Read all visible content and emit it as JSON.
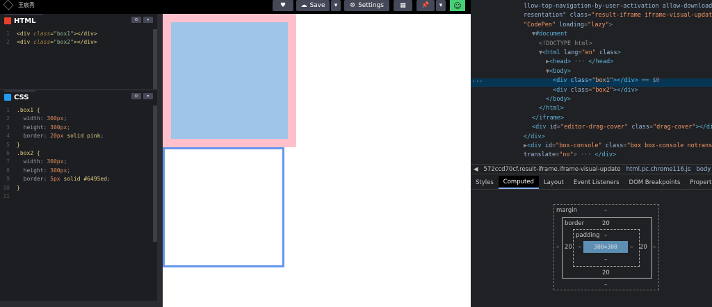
{
  "topbar": {
    "user_name": "王宸秀",
    "heart_icon_label": "♥",
    "save_label": "Save",
    "settings_label": "Settings",
    "avatar_glyph": "☺"
  },
  "html_panel": {
    "title": "HTML",
    "lines": [
      {
        "n": "1",
        "parts": [
          [
            "tag",
            "<div "
          ],
          [
            "attr",
            "class"
          ],
          [
            "tag",
            "="
          ],
          [
            "str",
            "\"box1\""
          ],
          [
            "tag",
            "></div>"
          ]
        ]
      },
      {
        "n": "2",
        "parts": [
          [
            "tag",
            "<div "
          ],
          [
            "attr",
            "class"
          ],
          [
            "tag",
            "="
          ],
          [
            "str",
            "\"box2\""
          ],
          [
            "tag",
            "></div>"
          ]
        ]
      }
    ]
  },
  "css_panel": {
    "title": "CSS",
    "lines": [
      {
        "n": "1",
        "parts": [
          [
            "sel",
            ".box1 {"
          ]
        ]
      },
      {
        "n": "2",
        "parts": [
          [
            "prop",
            "  width: "
          ],
          [
            "num",
            "300px"
          ],
          [
            "prop",
            ";"
          ]
        ]
      },
      {
        "n": "3",
        "parts": [
          [
            "prop",
            "  height: "
          ],
          [
            "num",
            "300px"
          ],
          [
            "prop",
            ";"
          ]
        ]
      },
      {
        "n": "4",
        "parts": [
          [
            "prop",
            "  border: "
          ],
          [
            "num",
            "20px"
          ],
          [
            "prop",
            " "
          ],
          [
            "kw",
            "solid pink"
          ],
          [
            "prop",
            ";"
          ]
        ]
      },
      {
        "n": "5",
        "parts": [
          [
            "sel",
            "}"
          ]
        ]
      },
      {
        "n": "6",
        "parts": [
          [
            "sel",
            ".box2 {"
          ]
        ]
      },
      {
        "n": "7",
        "parts": [
          [
            "prop",
            "  width: "
          ],
          [
            "num",
            "300px"
          ],
          [
            "prop",
            ";"
          ]
        ]
      },
      {
        "n": "8",
        "parts": [
          [
            "prop",
            "  height: "
          ],
          [
            "num",
            "300px"
          ],
          [
            "prop",
            ";"
          ]
        ]
      },
      {
        "n": "9",
        "parts": [
          [
            "prop",
            "  border: "
          ],
          [
            "num",
            "5px"
          ],
          [
            "prop",
            " "
          ],
          [
            "kw",
            "solid #6495ed"
          ],
          [
            "prop",
            ";"
          ]
        ]
      },
      {
        "n": "10",
        "parts": [
          [
            "sel",
            "}"
          ]
        ]
      },
      {
        "n": "11",
        "parts": []
      }
    ]
  },
  "devtools": {
    "elements": [
      {
        "indent": 0,
        "parts": [
          [
            "attr",
            "llow-top-navigation-by-user-activation allow-downloads"
          ]
        ]
      },
      {
        "indent": 0,
        "parts": [
          [
            "attr",
            "resentation\" "
          ],
          [
            "dt-attr",
            "class"
          ],
          [
            "eq",
            "="
          ],
          [
            "val",
            "\"result-iframe iframe-visual-update"
          ]
        ]
      },
      {
        "indent": 0,
        "parts": [
          [
            "val",
            "\"CodePen\""
          ],
          [
            "attr",
            " loading"
          ],
          [
            "eq",
            "="
          ],
          [
            "val",
            "\"lazy\""
          ],
          [
            "eq",
            ">"
          ]
        ]
      },
      {
        "indent": 1,
        "parts": [
          [
            "eq",
            "▼"
          ],
          [
            "tag",
            "#document"
          ]
        ]
      },
      {
        "indent": 2,
        "parts": [
          [
            "eq",
            "<!DOCTYPE html>"
          ]
        ]
      },
      {
        "indent": 2,
        "parts": [
          [
            "eq",
            "▼"
          ],
          [
            "tag",
            "<html "
          ],
          [
            "attr",
            "lang"
          ],
          [
            "eq",
            "="
          ],
          [
            "val",
            "\"en\""
          ],
          [
            "attr",
            " class"
          ],
          [
            "tag",
            ">"
          ]
        ]
      },
      {
        "indent": 3,
        "parts": [
          [
            "eq",
            "▶"
          ],
          [
            "tag",
            "<head>"
          ],
          [
            "eq",
            " ··· "
          ],
          [
            "tag",
            "</head>"
          ]
        ]
      },
      {
        "indent": 3,
        "parts": [
          [
            "eq",
            "▼"
          ],
          [
            "tag",
            "<body>"
          ]
        ]
      },
      {
        "indent": 4,
        "parts": [
          [
            "tag",
            "<div "
          ],
          [
            "attr",
            "class"
          ],
          [
            "eq",
            "="
          ],
          [
            "val",
            "\"box1\""
          ],
          [
            "tag",
            "></div>"
          ],
          [
            "eq",
            " == $0"
          ]
        ]
      },
      {
        "indent": 4,
        "parts": [
          [
            "tag",
            "<div "
          ],
          [
            "attr",
            "class"
          ],
          [
            "eq",
            "="
          ],
          [
            "val",
            "\"box2\""
          ],
          [
            "tag",
            "></div>"
          ]
        ]
      },
      {
        "indent": 3,
        "parts": [
          [
            "tag",
            "</body>"
          ]
        ]
      },
      {
        "indent": 2,
        "parts": [
          [
            "tag",
            "</html>"
          ]
        ]
      },
      {
        "indent": 1,
        "parts": [
          [
            "tag",
            "</iframe>"
          ]
        ]
      },
      {
        "indent": 1,
        "parts": [
          [
            "tag",
            "<div "
          ],
          [
            "attr",
            "id"
          ],
          [
            "eq",
            "="
          ],
          [
            "val",
            "\"editor-drag-cover\""
          ],
          [
            "attr",
            " class"
          ],
          [
            "eq",
            "="
          ],
          [
            "val",
            "\"drag-cover\""
          ],
          [
            "tag",
            "></div>"
          ]
        ]
      },
      {
        "indent": 0,
        "parts": [
          [
            "tag",
            "</div>"
          ]
        ]
      },
      {
        "indent": 0,
        "parts": [
          [
            "eq",
            "▶"
          ],
          [
            "tag",
            "<div "
          ],
          [
            "attr",
            "id"
          ],
          [
            "eq",
            "="
          ],
          [
            "val",
            "\"box-console\""
          ],
          [
            "attr",
            " class"
          ],
          [
            "eq",
            "="
          ],
          [
            "val",
            "\"box box-console notranslate"
          ]
        ]
      },
      {
        "indent": 0,
        "parts": [
          [
            "attr",
            "translate"
          ],
          [
            "eq",
            "="
          ],
          [
            "val",
            "\"no\""
          ],
          [
            "eq",
            "> ··· "
          ],
          [
            "tag",
            "</div>"
          ]
        ]
      }
    ],
    "selected_dots": "···",
    "breadcrumbs": [
      {
        "label": "◀",
        "active": false
      },
      {
        "label": "572ccd70cf.result-iframe.iframe-visual-update",
        "active": false
      },
      {
        "label": "html.pc.chrome116.js",
        "active": true
      },
      {
        "label": "body",
        "active": true
      },
      {
        "label": "d",
        "active": false
      }
    ],
    "tabs": [
      {
        "label": "Styles",
        "active": false
      },
      {
        "label": "Computed",
        "active": true
      },
      {
        "label": "Layout",
        "active": false
      },
      {
        "label": "Event Listeners",
        "active": false
      },
      {
        "label": "DOM Breakpoints",
        "active": false
      },
      {
        "label": "Properties",
        "active": false
      }
    ],
    "box_model": {
      "margin_label": "margin",
      "margin_top": "–",
      "margin_bottom": "–",
      "margin_left": "–",
      "margin_right": "–",
      "border_label": "border",
      "border_top": "20",
      "border_bottom": "20",
      "border_left": "20",
      "border_right": "20",
      "padding_label": "padding",
      "padding_top": "–",
      "padding_bottom": "–",
      "padding_left": "–",
      "padding_right": "–",
      "content": "300×300"
    }
  },
  "colors": {
    "box1_border": "#ffc0cb",
    "box1_fill": "#9fc5e8",
    "box2_border": "#6495ed",
    "html_icon": "#e8412a",
    "css_icon": "#1f9cf0",
    "avatar_bg": "#47cf73"
  }
}
